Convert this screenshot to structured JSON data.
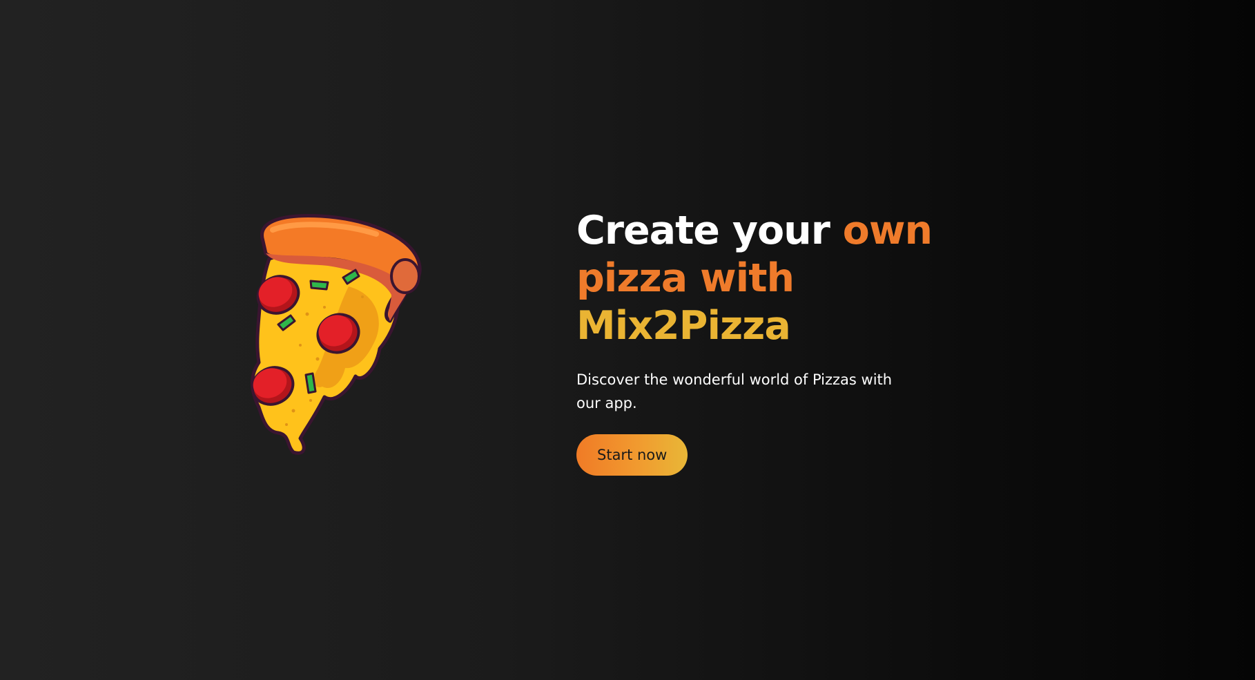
{
  "hero": {
    "title_part1": "Create your ",
    "title_part2": "own pizza with",
    "title_part3": "Mix2Pizza",
    "subtitle": "Discover the wonderful world of Pizzas with our app.",
    "cta_label": "Start now"
  },
  "colors": {
    "background": "#1b1b1b",
    "title_white": "#ffffff",
    "accent_orange": "#ef7b2b",
    "accent_gold": "#eab433"
  },
  "icons": {
    "pizza": "pizza-slice-illustration"
  }
}
